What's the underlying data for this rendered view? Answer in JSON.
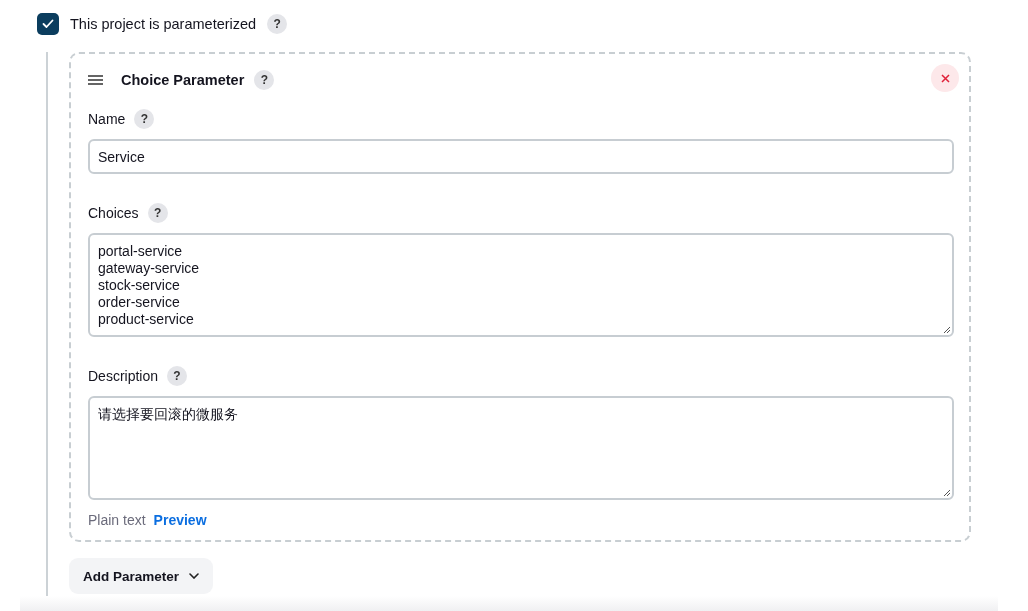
{
  "parameterized": {
    "label": "This project is parameterized",
    "checked": true,
    "help": "?"
  },
  "parameter": {
    "title": "Choice Parameter",
    "help": "?",
    "fields": [
      {
        "kind": "input",
        "label": "Name",
        "help": "?",
        "value": "Service"
      },
      {
        "kind": "textarea",
        "label": "Choices",
        "help": "?",
        "lines": [
          "portal-service",
          "gateway-service",
          "stock-service",
          "order-service",
          "product-service"
        ]
      },
      {
        "kind": "textarea",
        "label": "Description",
        "help": "?",
        "lines": [
          "请选择要回滚的微服务"
        ]
      }
    ],
    "format": {
      "plain": "Plain text",
      "preview": "Preview"
    }
  },
  "add_button": {
    "label": "Add Parameter"
  }
}
